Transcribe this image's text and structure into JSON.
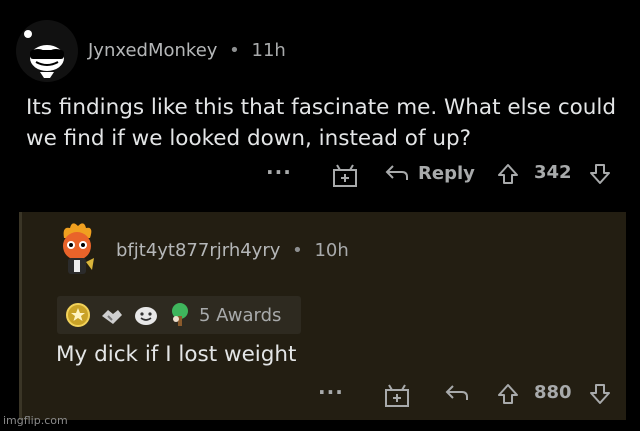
{
  "comment": {
    "username": "JynxedMonkey",
    "separator": "•",
    "time": "11h",
    "body": "Its findings like this that fascinate me. What else could we find if we looked down, instead of up?",
    "more_icon": "more-dots-icon",
    "award_icon": "gift-plus-icon",
    "reply_icon": "reply-arrow-icon",
    "reply_label": "Reply",
    "upvote_icon": "upvote-arrow-icon",
    "score": "342",
    "downvote_icon": "downvote-arrow-icon"
  },
  "reply": {
    "username": "bfjt4yt877rjrh4yry",
    "separator": "•",
    "time": "10h",
    "awards_label": "5 Awards",
    "award_icons": [
      "gold-award-icon",
      "handshake-award-icon",
      "smile-award-icon",
      "tree-award-icon"
    ],
    "body": "My dick if I lost weight",
    "score": "880"
  },
  "watermark": "imgflip.com",
  "colors": {
    "background": "#000000",
    "reply_background": "#231e12",
    "muted_text": "#a8aaab",
    "body_text": "#e3e5e6"
  }
}
